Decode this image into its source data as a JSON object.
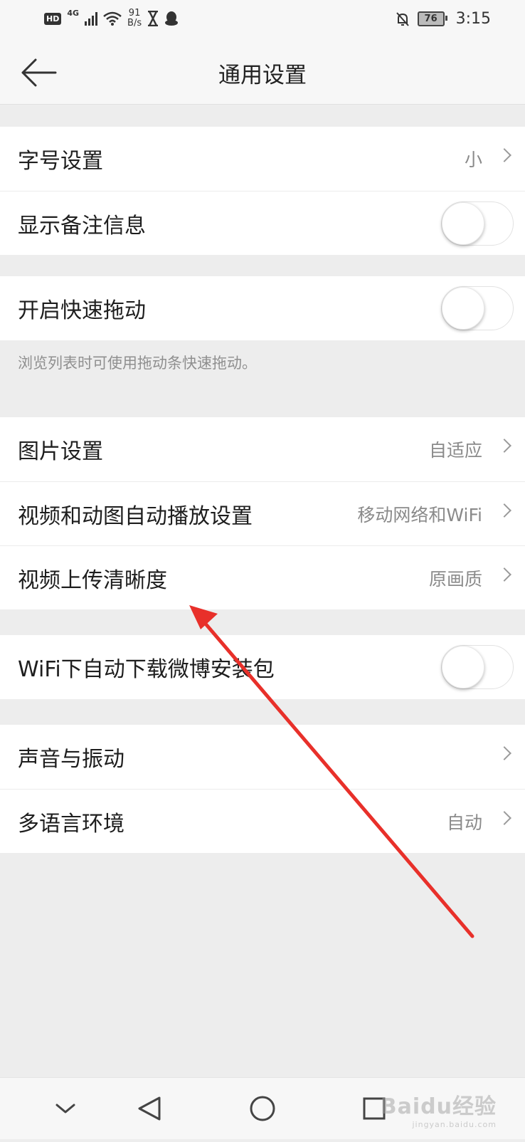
{
  "status_bar": {
    "hd": "HD",
    "network": "4G",
    "speed_value": "91",
    "speed_unit": "B/s",
    "battery": "76",
    "time": "3:15"
  },
  "header": {
    "title": "通用设置"
  },
  "groups": [
    [
      {
        "label": "字号设置",
        "value": "小",
        "type": "link"
      },
      {
        "label": "显示备注信息",
        "type": "toggle",
        "on": false
      }
    ],
    [
      {
        "label": "开启快速拖动",
        "type": "toggle",
        "on": false
      }
    ],
    [
      {
        "label": "图片设置",
        "value": "自适应",
        "type": "link"
      },
      {
        "label": "视频和动图自动播放设置",
        "value": "移动网络和WiFi",
        "type": "link"
      },
      {
        "label": "视频上传清晰度",
        "value": "原画质",
        "type": "link"
      }
    ],
    [
      {
        "label": "WiFi下自动下载微博安装包",
        "type": "toggle",
        "on": false
      }
    ],
    [
      {
        "label": "声音与振动",
        "value": "",
        "type": "link"
      },
      {
        "label": "多语言环境",
        "value": "自动",
        "type": "link"
      }
    ]
  ],
  "hint": "浏览列表时可使用拖动条快速拖动。",
  "watermark": {
    "brand": "Baidu经验",
    "url": "jingyan.baidu.com"
  },
  "colors": {
    "annotation_arrow": "#e8302a",
    "background": "#ededed"
  }
}
